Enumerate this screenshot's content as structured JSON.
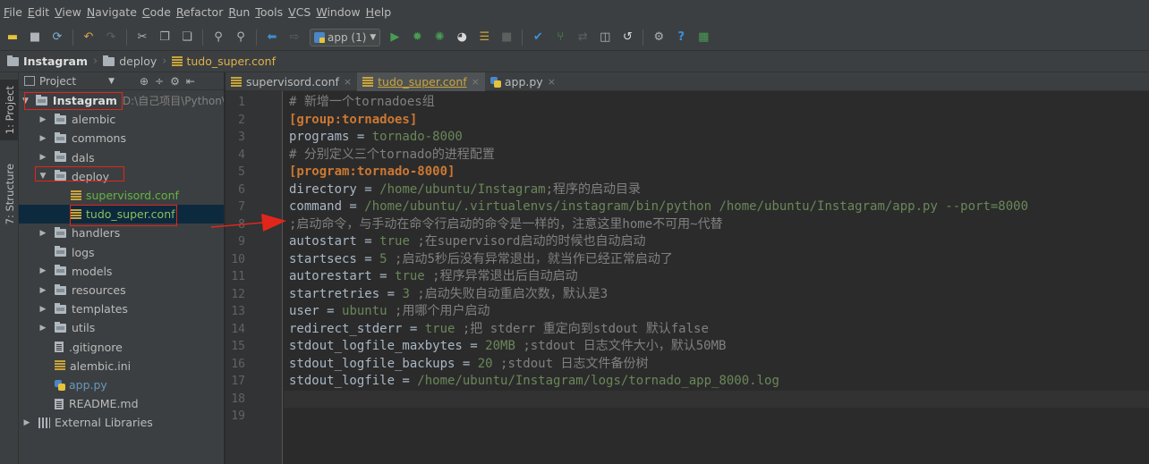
{
  "menu": [
    "File",
    "Edit",
    "View",
    "Navigate",
    "Code",
    "Refactor",
    "Run",
    "Tools",
    "VCS",
    "Window",
    "Help"
  ],
  "toolbar": {
    "run_config": "app (1)",
    "icons": [
      "open-icon",
      "save-icon",
      "sync-icon",
      "back-icon",
      "forward-icon",
      "cut-icon",
      "copy-icon",
      "paste-icon",
      "find-icon",
      "replace-icon",
      "nav-back-icon",
      "nav-forward-icon",
      "run-icon",
      "debug-icon",
      "coverage-icon",
      "profile-icon",
      "concurrency-icon",
      "stop-icon",
      "vcs-update-icon",
      "vcs-commit-icon",
      "vcs-compare-icon",
      "vcs-history-icon",
      "revert-icon",
      "settings-icon",
      "help-icon",
      "structure-icon"
    ]
  },
  "breadcrumb": [
    "Instagram",
    "deploy",
    "tudo_super.conf"
  ],
  "side_tabs": {
    "project": "1: Project",
    "structure": "7: Structure"
  },
  "project_panel": {
    "title": "Project",
    "tree": [
      {
        "label": "Instagram",
        "path": "D:\\自己项目\\Python\\I",
        "type": "folder",
        "open": true,
        "level": 0
      },
      {
        "label": "alembic",
        "type": "folder",
        "level": 1
      },
      {
        "label": "commons",
        "type": "folder",
        "level": 1
      },
      {
        "label": "dals",
        "type": "folder",
        "level": 1
      },
      {
        "label": "deploy",
        "type": "folder",
        "open": true,
        "level": 1
      },
      {
        "label": "supervisord.conf",
        "type": "conf",
        "level": 2
      },
      {
        "label": "tudo_super.conf",
        "type": "conf",
        "level": 2,
        "selected": true
      },
      {
        "label": "handlers",
        "type": "folder",
        "level": 1
      },
      {
        "label": "logs",
        "type": "folder-plain",
        "level": 1
      },
      {
        "label": "models",
        "type": "folder",
        "level": 1
      },
      {
        "label": "resources",
        "type": "folder",
        "level": 1
      },
      {
        "label": "templates",
        "type": "folder",
        "level": 1
      },
      {
        "label": "utils",
        "type": "folder",
        "level": 1
      },
      {
        "label": ".gitignore",
        "type": "text",
        "level": 1
      },
      {
        "label": "alembic.ini",
        "type": "conf-plain",
        "level": 1
      },
      {
        "label": "app.py",
        "type": "py",
        "level": 1
      },
      {
        "label": "README.md",
        "type": "text",
        "level": 1
      },
      {
        "label": "External Libraries",
        "type": "libs",
        "level": 0
      }
    ]
  },
  "tabs": [
    {
      "label": "supervisord.conf",
      "active": false
    },
    {
      "label": "tudo_super.conf",
      "active": true
    },
    {
      "label": "app.py",
      "active": false
    }
  ],
  "editor": {
    "current_line": 18,
    "lines": [
      "# 新增一个tornadoes组",
      "[group:tornadoes]",
      "programs = tornado-8000",
      "# 分别定义三个tornado的进程配置",
      "[program:tornado-8000]",
      "directory = /home/ubuntu/Instagram;程序的启动目录",
      "command = /home/ubuntu/.virtualenvs/instagram/bin/python /home/ubuntu/Instagram/app.py --port=8000",
      ";启动命令，与手动在命令行启动的命令是一样的，注意这里home不可用~代替",
      "autostart = true ;在supervisord启动的时候也自动启动",
      "startsecs = 5 ;启动5秒后没有异常退出，就当作已经正常启动了",
      "autorestart = true ;程序异常退出后自动启动",
      "startretries = 3 ;启动失败自动重启次数，默认是3",
      "user = ubuntu ;用哪个用户启动",
      "redirect_stderr = true ;把 stderr 重定向到stdout 默认false",
      "stdout_logfile_maxbytes = 20MB ;stdout 日志文件大小，默认50MB",
      "stdout_logfile_backups = 20 ;stdout 日志文件备份树",
      "stdout_logfile = /home/ubuntu/Instagram/logs/tornado_app_8000.log",
      "",
      ""
    ]
  },
  "colors": {
    "annotation": "#e0261b",
    "keyword": "#cc7832",
    "value": "#6a8759",
    "comment": "#808080"
  }
}
